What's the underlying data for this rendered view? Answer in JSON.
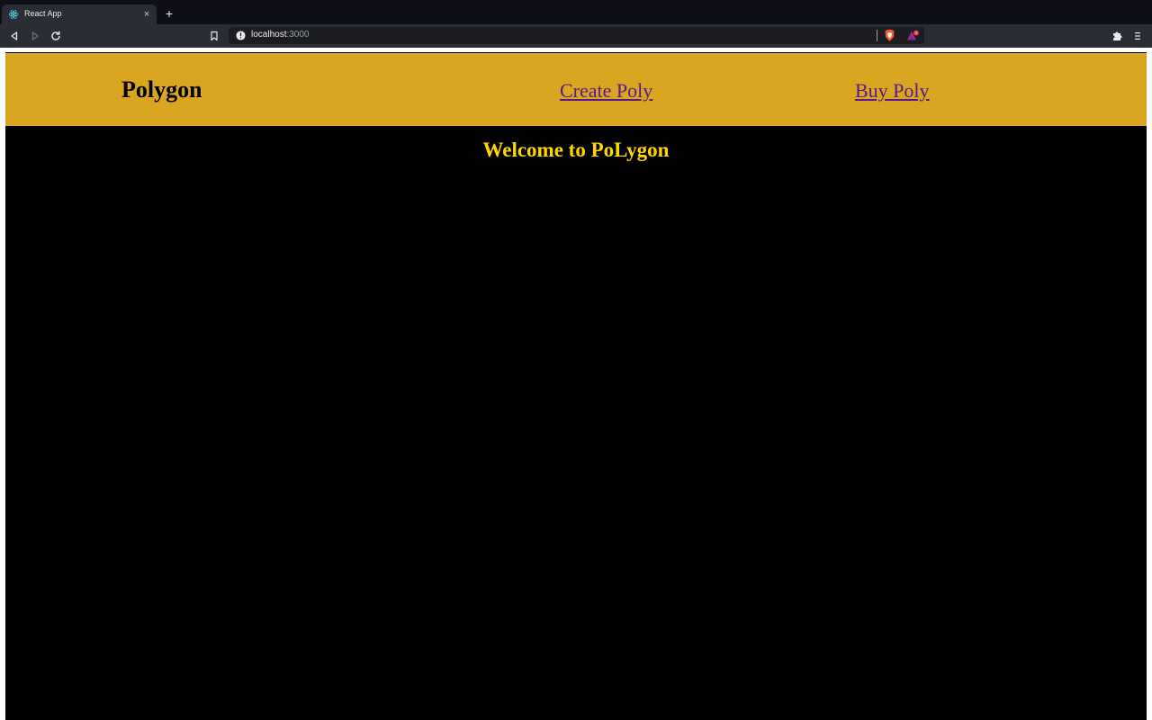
{
  "browser": {
    "tab": {
      "title": "React App",
      "favicon": "react-logo-icon"
    },
    "new_tab_symbol": "+",
    "close_symbol": "×",
    "address": {
      "host": "localhost",
      "port": ":3000"
    },
    "rewards_badge_count": "1",
    "colors": {
      "tabstrip": "#0f1017",
      "toolbar": "#2b2d35",
      "omnibox": "#1c1d22"
    }
  },
  "app": {
    "brand": "Polygon",
    "nav": {
      "create_label": "Create Poly",
      "buy_label": "Buy Poly"
    },
    "welcome": "Welcome to PoLygon",
    "colors": {
      "navbar_bg": "#daa520",
      "page_bg": "#000000",
      "welcome_text": "#ffd700",
      "link": "#551a8b"
    }
  }
}
